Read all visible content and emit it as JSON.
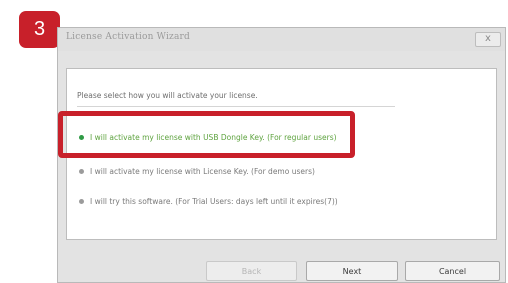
{
  "step": {
    "number": "3"
  },
  "window": {
    "title": "License Activation Wizard",
    "close_label": "x"
  },
  "prompt": "Please select how you will activate your license.",
  "options": [
    {
      "label": "I will activate my license with USB Dongle Key. (For regular users)",
      "selected": true
    },
    {
      "label": "I will activate my license with License Key. (For demo users)",
      "selected": false
    },
    {
      "label": "I will try this software. (For Trial Users: days left until it expires(7))",
      "selected": false
    }
  ],
  "buttons": {
    "back": "Back",
    "next": "Next",
    "cancel": "Cancel"
  },
  "colors": {
    "accent_red": "#c8202a",
    "selected_green": "#5ea33f"
  }
}
